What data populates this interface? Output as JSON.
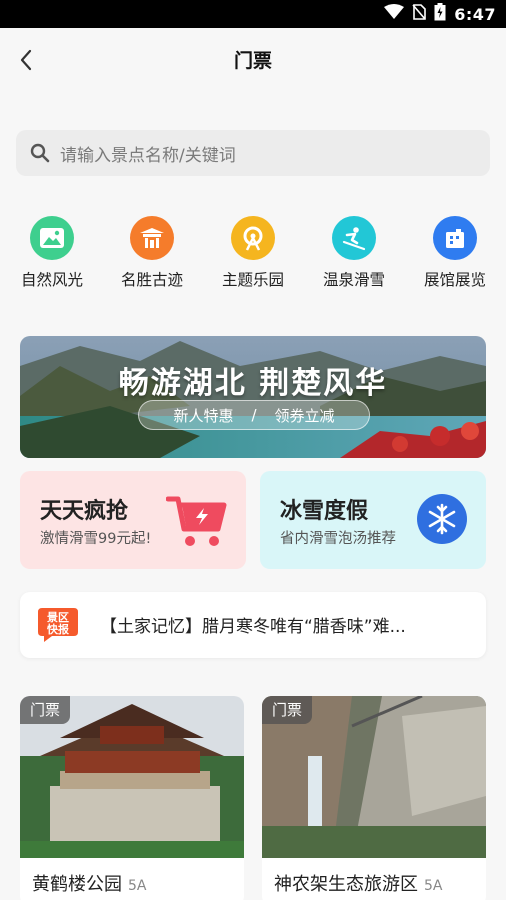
{
  "status_bar": {
    "time": "6:47"
  },
  "header": {
    "title": "门票"
  },
  "search": {
    "placeholder": "请输入景点名称/关键词"
  },
  "categories": [
    {
      "label": "自然风光",
      "icon": "landscape-icon",
      "color": "#3ecf8e"
    },
    {
      "label": "名胜古迹",
      "icon": "pavilion-icon",
      "color": "#f57c2b"
    },
    {
      "label": "主题乐园",
      "icon": "ferris-wheel-icon",
      "color": "#f5b51f"
    },
    {
      "label": "温泉滑雪",
      "icon": "skier-icon",
      "color": "#22c7d6"
    },
    {
      "label": "展馆展览",
      "icon": "museum-icon",
      "color": "#2f7cf0"
    }
  ],
  "banner": {
    "headline": "畅游湖北  荆楚风华",
    "pill_left": "新人特惠",
    "pill_sep": "/",
    "pill_right": "领券立减"
  },
  "promos": [
    {
      "title": "天天疯抢",
      "subtitle": "激情滑雪99元起!",
      "icon": "shopping-cart-icon",
      "color": "#ef4b5f"
    },
    {
      "title": "冰雪度假",
      "subtitle": "省内滑雪泡汤推荐",
      "icon": "snowflake-icon",
      "color": "#2f6fe0"
    }
  ],
  "news": {
    "badge_line1": "景区",
    "badge_line2": "快报",
    "text": "【土家记忆】腊月寒冬唯有“腊香味”难..."
  },
  "spots": [
    {
      "tag": "门票",
      "name": "黄鹤楼公园",
      "level": "5A"
    },
    {
      "tag": "门票",
      "name": "神农架生态旅游区",
      "level": "5A"
    }
  ]
}
